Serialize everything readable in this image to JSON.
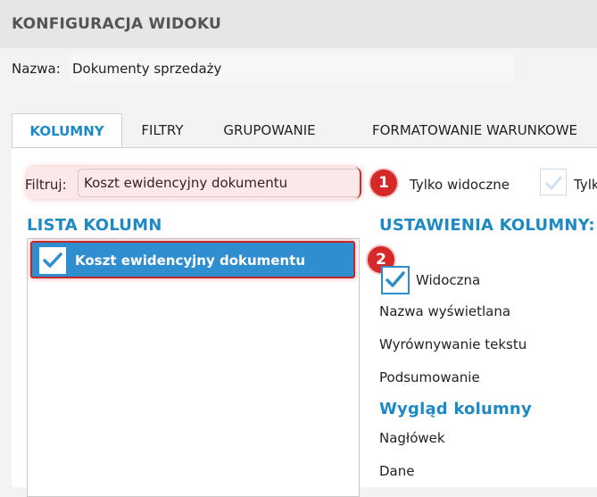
{
  "window": {
    "title": "KONFIGURACJA WIDOKU"
  },
  "name_field": {
    "label": "Nazwa:",
    "value": "Dokumenty sprzedaży"
  },
  "tabs": [
    {
      "label": "KOLUMNY",
      "active": true
    },
    {
      "label": "FILTRY",
      "active": false
    },
    {
      "label": "GRUPOWANIE",
      "active": false
    },
    {
      "label": "FORMATOWANIE WARUNKOWE",
      "active": false
    }
  ],
  "filter": {
    "label": "Filtruj:",
    "value": "Koszt ewidencyjny dokumentu",
    "only_visible_label": "Tylko widoczne",
    "second_option_label": "Tylk"
  },
  "annotations": {
    "badge_1": "1",
    "badge_2": "2",
    "color": "#d62828"
  },
  "column_list": {
    "title": "LISTA KOLUMN",
    "items": [
      {
        "label": "Koszt ewidencyjny dokumentu",
        "checked": true,
        "selected": true
      }
    ]
  },
  "column_settings": {
    "title": "USTAWIENIA KOLUMNY:",
    "visible_label": "Widoczna",
    "visible_checked": true,
    "display_name_label": "Nazwa wyświetlana",
    "text_alignment_label": "Wyrównywanie tekstu",
    "summary_label": "Podsumowanie",
    "appearance_title": "Wygląd kolumny",
    "header_label": "Nagłówek",
    "data_label": "Dane"
  },
  "colors": {
    "accent": "#1d8ac6",
    "selection": "#2f8ed0",
    "header_bg": "#e6e6e6"
  }
}
